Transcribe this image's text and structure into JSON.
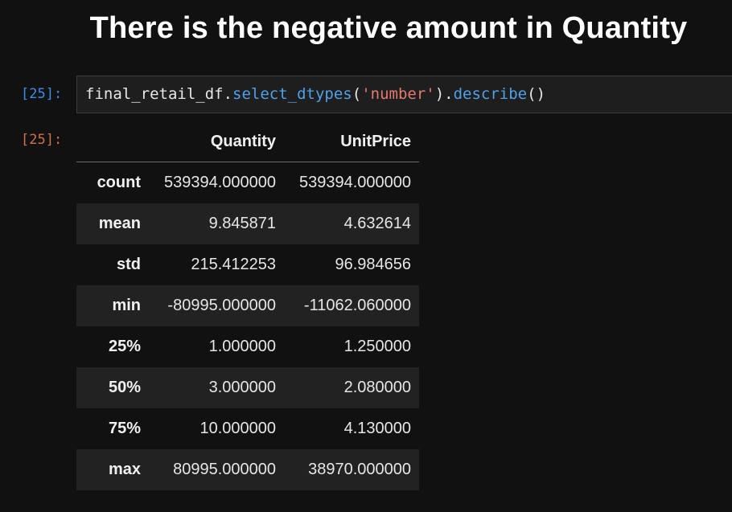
{
  "heading": "There is the negative amount in Quantity",
  "cell_in": {
    "prompt": "[25]:",
    "code_parts": [
      "final_retail_df.",
      "select_dtypes",
      "(",
      "'number'",
      ").",
      "describe",
      "()"
    ]
  },
  "cell_out": {
    "prompt": "[25]:",
    "table": {
      "columns": [
        "",
        "Quantity",
        "UnitPrice"
      ],
      "rows": [
        {
          "label": "count",
          "values": [
            "539394.000000",
            "539394.000000"
          ]
        },
        {
          "label": "mean",
          "values": [
            "9.845871",
            "4.632614"
          ]
        },
        {
          "label": "std",
          "values": [
            "215.412253",
            "96.984656"
          ]
        },
        {
          "label": "min",
          "values": [
            "-80995.000000",
            "-11062.060000"
          ]
        },
        {
          "label": "25%",
          "values": [
            "1.000000",
            "1.250000"
          ]
        },
        {
          "label": "50%",
          "values": [
            "3.000000",
            "2.080000"
          ]
        },
        {
          "label": "75%",
          "values": [
            "10.000000",
            "4.130000"
          ]
        },
        {
          "label": "max",
          "values": [
            "80995.000000",
            "38970.000000"
          ]
        }
      ]
    }
  }
}
